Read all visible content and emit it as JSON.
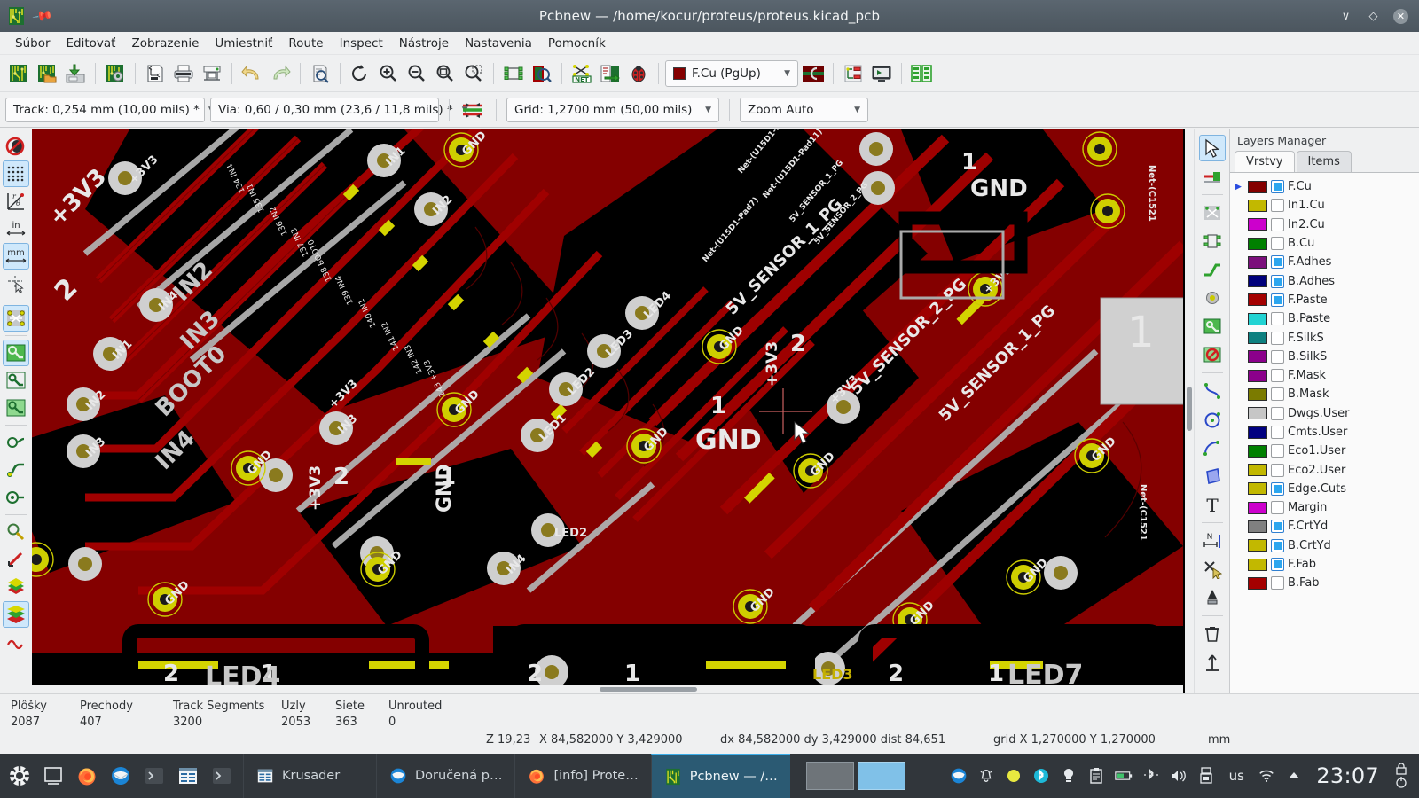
{
  "window": {
    "title": "Pcbnew — /home/kocur/proteus/proteus.kicad_pcb",
    "app_icon": "kicad-pcb-icon",
    "pin_icon": "pin-icon",
    "minimize_icon": "chevron-down-icon",
    "maximize_icon": "diamond-icon",
    "close_icon": "close-icon"
  },
  "menubar": {
    "items": [
      {
        "label": "Súbor",
        "name": "menu-file"
      },
      {
        "label": "Editovať",
        "name": "menu-edit"
      },
      {
        "label": "Zobrazenie",
        "name": "menu-view"
      },
      {
        "label": "Umiestniť",
        "name": "menu-place"
      },
      {
        "label": "Route",
        "name": "menu-route"
      },
      {
        "label": "Inspect",
        "name": "menu-inspect"
      },
      {
        "label": "Nástroje",
        "name": "menu-tools"
      },
      {
        "label": "Nastavenia",
        "name": "menu-preferences"
      },
      {
        "label": "Pomocník",
        "name": "menu-help"
      }
    ]
  },
  "toolbar_main": {
    "buttons": [
      {
        "name": "new-board-button",
        "icon": "board-new-icon",
        "tooltip": "New board"
      },
      {
        "name": "open-board-button",
        "icon": "board-open-icon",
        "tooltip": "Open board"
      },
      {
        "name": "save-board-button",
        "icon": "board-save-icon",
        "tooltip": "Save board"
      },
      {
        "name": "board-setup-button",
        "icon": "board-setup-gear-icon",
        "tooltip": "Board setup"
      },
      {
        "name": "page-settings-button",
        "icon": "page-settings-icon",
        "tooltip": "Page settings"
      },
      {
        "name": "print-button",
        "icon": "printer-icon",
        "tooltip": "Print"
      },
      {
        "name": "plot-button",
        "icon": "plotter-icon",
        "tooltip": "Plot"
      },
      {
        "name": "undo-button",
        "icon": "undo-arrow-icon",
        "tooltip": "Undo"
      },
      {
        "name": "redo-button",
        "icon": "redo-arrow-icon",
        "tooltip": "Redo"
      },
      {
        "name": "find-button",
        "icon": "find-magnifier-icon",
        "tooltip": "Find"
      },
      {
        "name": "refresh-button",
        "icon": "refresh-circular-arrow-icon",
        "tooltip": "Refresh"
      },
      {
        "name": "zoom-in-button",
        "icon": "zoom-in-icon",
        "tooltip": "Zoom in"
      },
      {
        "name": "zoom-out-button",
        "icon": "zoom-out-icon",
        "tooltip": "Zoom out"
      },
      {
        "name": "zoom-fit-button",
        "icon": "zoom-fit-page-icon",
        "tooltip": "Zoom to fit"
      },
      {
        "name": "zoom-area-button",
        "icon": "zoom-area-icon",
        "tooltip": "Zoom to selection"
      },
      {
        "name": "footprint-editor-button",
        "icon": "footprint-editor-icon",
        "tooltip": "Footprint editor"
      },
      {
        "name": "footprint-viewer-button",
        "icon": "footprint-viewer-icon",
        "tooltip": "Footprint viewer"
      },
      {
        "name": "netlist-button",
        "icon": "netlist-icon",
        "tooltip": "Load netlist"
      },
      {
        "name": "update-pcb-button",
        "icon": "update-pcb-from-schematic-icon",
        "tooltip": "Update PCB from schematic"
      },
      {
        "name": "drc-button",
        "icon": "drc-ladybug-icon",
        "tooltip": "Design rules checker"
      },
      {
        "name": "highlight-net-button",
        "icon": "highlight-net-icon",
        "tooltip": "Highlight net"
      },
      {
        "name": "show-ratsnest-button",
        "icon": "ratsnest-icon",
        "tooltip": "Show ratsnest"
      },
      {
        "name": "3d-viewer-button",
        "icon": "3d-viewer-icon",
        "tooltip": "3D viewer"
      },
      {
        "name": "layer-pair-button",
        "icon": "layer-pair-icon",
        "tooltip": "Select layer pair"
      }
    ],
    "layer_selector": {
      "label": "F.Cu (PgUp)",
      "color": "#840000",
      "name": "active-layer-selector"
    }
  },
  "toolbar_aux": {
    "track_width": {
      "label": "Track: 0,254 mm (10,00 mils) *",
      "name": "track-width-selector"
    },
    "via_size": {
      "label": "Via: 0,60 / 0,30 mm (23,6 / 11,8 mils) *",
      "name": "via-size-selector"
    },
    "track_via_sync_icon": "track-via-size-sync-icon",
    "grid": {
      "label": "Grid: 1,2700 mm (50,00 mils)",
      "name": "grid-selector"
    },
    "zoom": {
      "label": "Zoom Auto",
      "name": "zoom-selector"
    }
  },
  "left_toolbar": {
    "buttons": [
      {
        "name": "drc-disable-button",
        "icon": "drc-off-ladybug-icon",
        "active": false
      },
      {
        "name": "toggle-grid-button",
        "icon": "grid-dots-icon",
        "active": true
      },
      {
        "name": "polar-coords-button",
        "icon": "polar-coordinates-icon",
        "active": false
      },
      {
        "name": "units-inches-button",
        "icon": "inches-unit-icon",
        "active": false
      },
      {
        "name": "units-mm-button",
        "icon": "millimeters-unit-icon",
        "active": true
      },
      {
        "name": "cursor-shape-button",
        "icon": "full-crosshair-cursor-icon",
        "active": false
      },
      {
        "name": "show-ratsnest-button",
        "icon": "ratsnest-lines-icon",
        "active": true
      },
      {
        "name": "fill-zones-button",
        "icon": "zone-filled-icon",
        "active": true
      },
      {
        "name": "zone-outline-button",
        "icon": "zone-outline-icon",
        "active": false
      },
      {
        "name": "zone-sketch-button",
        "icon": "zone-sketch-icon",
        "active": false
      },
      {
        "name": "via-sketch-button",
        "icon": "via-sketch-icon",
        "active": false
      },
      {
        "name": "track-sketch-button",
        "icon": "track-sketch-icon",
        "active": false
      },
      {
        "name": "pad-sketch-button",
        "icon": "pad-sketch-icon",
        "active": false
      },
      {
        "name": "high-contrast-button",
        "icon": "layer-contrast-icon",
        "active": true
      },
      {
        "name": "text-sketch-button",
        "icon": "text-sketch-icon",
        "active": false
      }
    ]
  },
  "right_toolbar": {
    "buttons": [
      {
        "name": "select-tool-button",
        "icon": "cursor-arrow-icon",
        "active": true
      },
      {
        "name": "highlight-net-tool-button",
        "icon": "highlight-net-tool-icon",
        "active": false
      },
      {
        "name": "local-ratsnest-button",
        "icon": "local-ratsnest-icon",
        "active": false
      },
      {
        "name": "add-footprint-button",
        "icon": "add-footprint-icon",
        "active": false
      },
      {
        "name": "route-track-button",
        "icon": "route-track-icon",
        "active": false
      },
      {
        "name": "add-via-button",
        "icon": "add-via-icon",
        "active": false
      },
      {
        "name": "add-zone-button",
        "icon": "add-filled-zone-icon",
        "active": false
      },
      {
        "name": "add-keepout-button",
        "icon": "add-keepout-zone-icon",
        "active": false
      },
      {
        "name": "draw-line-button",
        "icon": "draw-polyline-icon",
        "active": false
      },
      {
        "name": "draw-circle-button",
        "icon": "draw-circle-icon",
        "active": false
      },
      {
        "name": "draw-arc-button",
        "icon": "draw-arc-icon",
        "active": false
      },
      {
        "name": "draw-polygon-button",
        "icon": "draw-polygon-icon",
        "active": false
      },
      {
        "name": "draw-text-button",
        "icon": "add-text-icon",
        "active": false
      },
      {
        "name": "add-dimension-button",
        "icon": "add-dimension-icon",
        "active": false
      },
      {
        "name": "delete-tool-button",
        "icon": "delete-cursor-icon",
        "active": false
      },
      {
        "name": "set-origin-button",
        "icon": "set-drill-origin-icon",
        "active": false
      },
      {
        "name": "measure-button",
        "icon": "measure-ruler-icon",
        "active": false
      }
    ]
  },
  "layers_manager": {
    "title": "Layers Manager",
    "tabs": [
      {
        "label": "Vrstvy",
        "name": "tab-layers",
        "active": true
      },
      {
        "label": "Items",
        "name": "tab-items",
        "active": false
      }
    ],
    "layers": [
      {
        "name": "F.Cu",
        "color": "#840000",
        "visible": true,
        "selected": true
      },
      {
        "name": "In1.Cu",
        "color": "#c2b800",
        "visible": false,
        "selected": false
      },
      {
        "name": "In2.Cu",
        "color": "#cc00cc",
        "visible": false,
        "selected": false
      },
      {
        "name": "B.Cu",
        "color": "#008000",
        "visible": false,
        "selected": false
      },
      {
        "name": "F.Adhes",
        "color": "#7b0f7b",
        "visible": true,
        "selected": false
      },
      {
        "name": "B.Adhes",
        "color": "#00007b",
        "visible": true,
        "selected": false
      },
      {
        "name": "F.Paste",
        "color": "#a40000",
        "visible": true,
        "selected": false
      },
      {
        "name": "B.Paste",
        "color": "#22d3d3",
        "visible": false,
        "selected": false
      },
      {
        "name": "F.SilkS",
        "color": "#0e8080",
        "visible": false,
        "selected": false
      },
      {
        "name": "B.SilkS",
        "color": "#8b008b",
        "visible": false,
        "selected": false
      },
      {
        "name": "F.Mask",
        "color": "#8b008b",
        "visible": false,
        "selected": false
      },
      {
        "name": "B.Mask",
        "color": "#7b7b00",
        "visible": false,
        "selected": false
      },
      {
        "name": "Dwgs.User",
        "color": "#c6c6c6",
        "visible": false,
        "selected": false
      },
      {
        "name": "Cmts.User",
        "color": "#000080",
        "visible": false,
        "selected": false
      },
      {
        "name": "Eco1.User",
        "color": "#008000",
        "visible": false,
        "selected": false
      },
      {
        "name": "Eco2.User",
        "color": "#c2b800",
        "visible": false,
        "selected": false
      },
      {
        "name": "Edge.Cuts",
        "color": "#c2b800",
        "visible": true,
        "selected": false
      },
      {
        "name": "Margin",
        "color": "#cc00cc",
        "visible": false,
        "selected": false
      },
      {
        "name": "F.CrtYd",
        "color": "#808080",
        "visible": true,
        "selected": false
      },
      {
        "name": "B.CrtYd",
        "color": "#c2b800",
        "visible": true,
        "selected": false
      },
      {
        "name": "F.Fab",
        "color": "#c2b800",
        "visible": true,
        "selected": false
      },
      {
        "name": "B.Fab",
        "color": "#a40000",
        "visible": false,
        "selected": false
      }
    ]
  },
  "statusbar": {
    "counters": [
      {
        "label": "Plôšky",
        "value": "2087",
        "name": "stat-pads"
      },
      {
        "label": "Prechody",
        "value": "407",
        "name": "stat-vias"
      },
      {
        "label": "Track Segments",
        "value": "3200",
        "name": "stat-tracks"
      },
      {
        "label": "Uzly",
        "value": "2053",
        "name": "stat-nodes"
      },
      {
        "label": "Siete",
        "value": "363",
        "name": "stat-nets"
      },
      {
        "label": "Unrouted",
        "value": "0",
        "name": "stat-unrouted"
      }
    ],
    "zoom": "Z 19,23",
    "cursor": "X 84,582000 Y 3,429000",
    "delta": "dx 84,582000  dy 3,429000  dist 84,651",
    "grid": "grid X 1,270000  Y 1,270000",
    "units": "mm"
  },
  "taskbar": {
    "launchers": [
      {
        "name": "application-menu-button",
        "icon": "kubuntu-menu-icon"
      },
      {
        "name": "show-desktop-button",
        "icon": "desktop-square-icon"
      },
      {
        "name": "firefox-launcher",
        "icon": "firefox-icon"
      },
      {
        "name": "thunderbird-launcher",
        "icon": "thunderbird-icon"
      },
      {
        "name": "terminal-launcher",
        "icon": "terminal-prompt-icon"
      },
      {
        "name": "krusader-launcher",
        "icon": "krusader-icon"
      },
      {
        "name": "terminal-launcher-2",
        "icon": "terminal-prompt-icon"
      }
    ],
    "tasks": [
      {
        "label": "Krusader",
        "icon": "krusader-icon",
        "active": false,
        "name": "task-krusader"
      },
      {
        "label": "Doručená p…",
        "icon": "thunderbird-icon",
        "active": false,
        "name": "task-thunderbird"
      },
      {
        "label": "[info] Prote…",
        "icon": "firefox-icon",
        "active": false,
        "name": "task-firefox"
      },
      {
        "label": "Pcbnew — /…",
        "icon": "kicad-pcb-icon",
        "active": true,
        "name": "task-pcbnew"
      }
    ],
    "pager": [
      {
        "name": "desktop-1",
        "active": false
      },
      {
        "name": "desktop-2",
        "active": true
      }
    ],
    "tray": [
      {
        "name": "tray-thunderbird-icon",
        "glyph": "thunderbird"
      },
      {
        "name": "tray-notifications-icon",
        "glyph": "bell"
      },
      {
        "name": "tray-status-icon",
        "glyph": "circle"
      },
      {
        "name": "tray-bluetooth-icon",
        "glyph": "bluetooth-on"
      },
      {
        "name": "tray-brightness-icon",
        "glyph": "bulb"
      },
      {
        "name": "tray-clipboard-icon",
        "glyph": "clipboard"
      },
      {
        "name": "tray-battery-icon",
        "glyph": "battery"
      },
      {
        "name": "tray-bluetooth-transfer-icon",
        "glyph": "bluetooth"
      },
      {
        "name": "tray-volume-icon",
        "glyph": "speaker"
      },
      {
        "name": "tray-removable-device-icon",
        "glyph": "usb"
      }
    ],
    "keyboard_layout": "us",
    "network_icon": "wifi-icon",
    "show-hidden-icon": "chevron-up-icon",
    "clock": "23:07",
    "lock_icon": "lock-power-icon"
  },
  "canvas": {
    "name": "pcb-canvas",
    "background": "#000000",
    "copper_color": "#840000",
    "silkscreen_color": "#b8b8b8",
    "pad_color": "#cfcfcf",
    "via_color": "#c2b800",
    "edge_cuts_color": "#cccc00"
  }
}
